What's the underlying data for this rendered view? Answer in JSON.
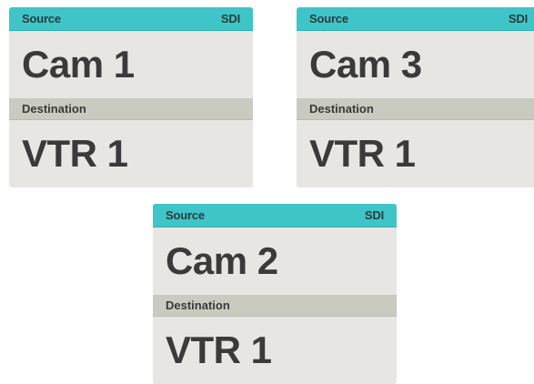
{
  "panels": [
    {
      "source_label": "Source",
      "format": "SDI",
      "source_name": "Cam 1",
      "destination_label": "Destination",
      "destination_name": "VTR 1"
    },
    {
      "source_label": "Source",
      "format": "SDI",
      "source_name": "Cam 3",
      "destination_label": "Destination",
      "destination_name": "VTR 1"
    },
    {
      "source_label": "Source",
      "format": "SDI",
      "source_name": "Cam 2",
      "destination_label": "Destination",
      "destination_name": "VTR 1"
    }
  ],
  "colors": {
    "source_bar": "#3fc5c8",
    "destination_bar": "#c9cac0",
    "panel_background": "#e8e6e2",
    "text": "#3a3a3a"
  }
}
